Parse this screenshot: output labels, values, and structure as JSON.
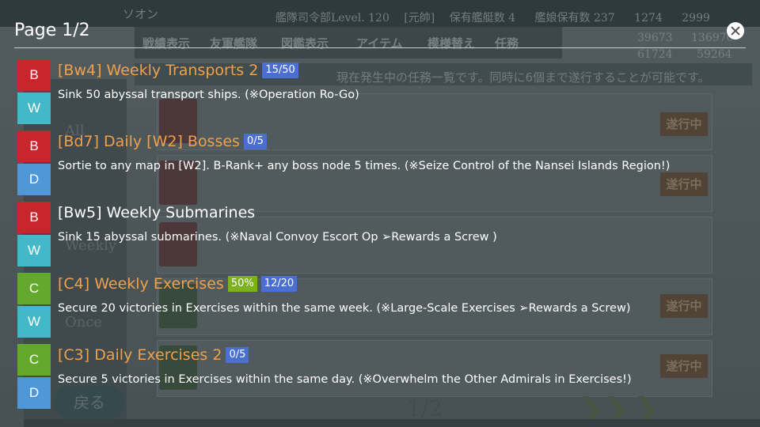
{
  "overlay": {
    "page_title": "Page 1/2",
    "close_icon": "close-icon",
    "quests": [
      {
        "cat_top": "B",
        "cat_top_color": "#c8262c",
        "cat_bottom": "W",
        "cat_bottom_color": "#43b8c8",
        "title": "[Bw4] Weekly Transports 2",
        "title_color": "orange",
        "tags": [
          {
            "text": "15/50",
            "color": "blue"
          }
        ],
        "desc": "Sink 50 abyssal transport ships. (※Operation Ro-Go)"
      },
      {
        "cat_top": "B",
        "cat_top_color": "#c8262c",
        "cat_bottom": "D",
        "cat_bottom_color": "#4f97d6",
        "title": "[Bd7] Daily [W2] Bosses",
        "title_color": "orange",
        "tags": [
          {
            "text": "0/5",
            "color": "blue"
          }
        ],
        "desc": "Sortie to any map in [W2]. B-Rank+ any boss node 5 times. (※Seize Control of the Nansei Islands Region!)"
      },
      {
        "cat_top": "B",
        "cat_top_color": "#c8262c",
        "cat_bottom": "W",
        "cat_bottom_color": "#43b8c8",
        "title": "[Bw5] Weekly Submarines",
        "title_color": "white",
        "tags": [],
        "desc": "Sink 15 abyssal submarines. (※Naval Convoy Escort Op ➢Rewards a Screw )"
      },
      {
        "cat_top": "C",
        "cat_top_color": "#63a92c",
        "cat_bottom": "W",
        "cat_bottom_color": "#43b8c8",
        "title": "[C4] Weekly Exercises",
        "title_color": "orange",
        "tags": [
          {
            "text": "50%",
            "color": "green"
          },
          {
            "text": "12/20",
            "color": "blue"
          }
        ],
        "desc": "Secure 20 victories in Exercises within the same week. (※Large-Scale Exercises ➢Rewards a Screw)"
      },
      {
        "cat_top": "C",
        "cat_top_color": "#63a92c",
        "cat_bottom": "D",
        "cat_bottom_color": "#4f97d6",
        "title": "[C3] Daily Exercises 2",
        "title_color": "orange",
        "tags": [
          {
            "text": "0/5",
            "color": "blue"
          }
        ],
        "desc": "Secure 5 victories in Exercises within the same day. (※Overwhelm the Other Admirals in Exercises!)"
      }
    ]
  },
  "game_bg": {
    "player_name": "ソオン",
    "level_label": "艦隊司令部Level. 120",
    "rank": "[元帥]",
    "ships_label": "保有艦艇数 4",
    "ship_count": "艦娘保有数 237",
    "fuel_top": "1274",
    "ammo_top": "2999",
    "menu": [
      "戦績表示",
      "友軍艦隊",
      "図鑑表示",
      "アイテム",
      "模様替え",
      "任務"
    ],
    "resources": [
      "39673",
      "136970",
      "61724",
      "59264"
    ],
    "notice": "現在発生中の任務一覧です。同時に6個まで遂行することが可能です。",
    "tabs": [
      "All",
      "Weekly",
      "Once"
    ],
    "in_progress": "遂行中",
    "page": "1/2",
    "back": "戻る"
  }
}
